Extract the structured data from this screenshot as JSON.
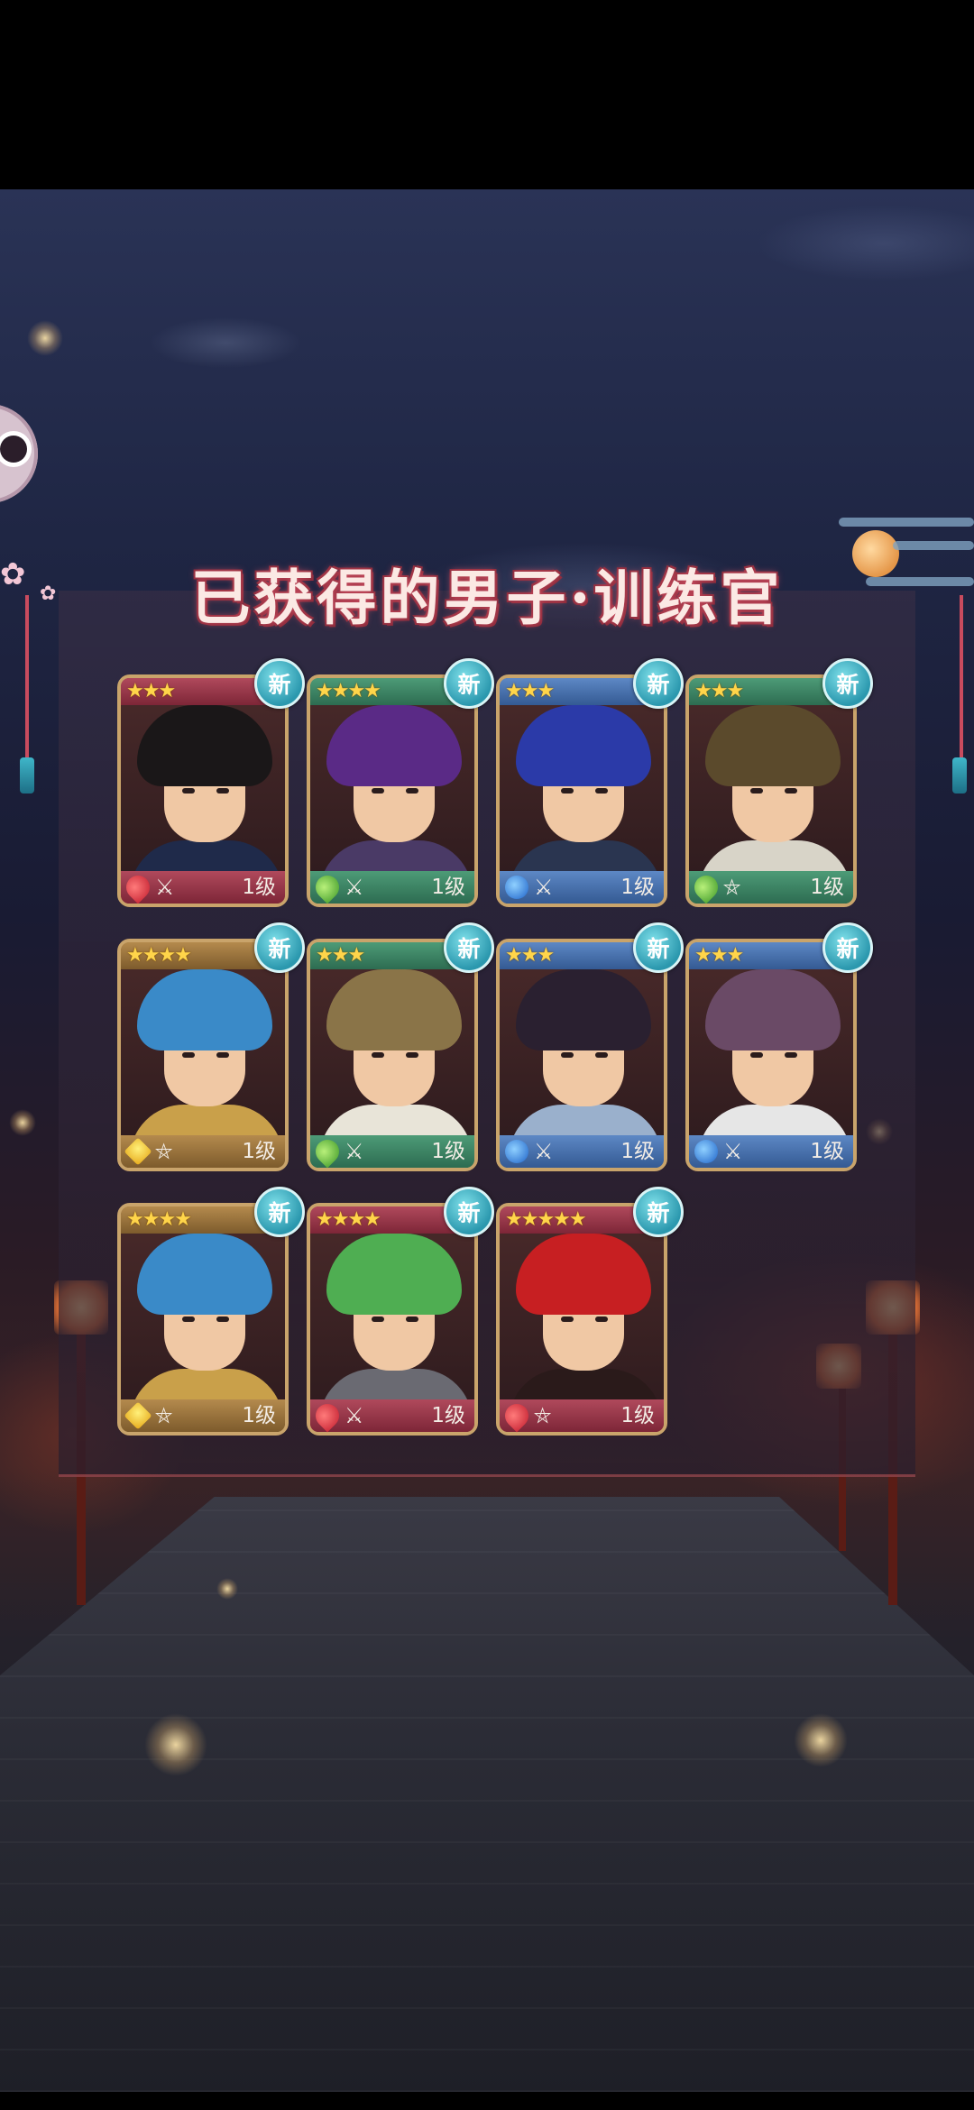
{
  "title": "已获得的男子·训练官",
  "cards": [
    {
      "stars": "★★★",
      "badge": "新",
      "element": "fire",
      "weapon": "⚔",
      "level": "1级",
      "theme": "red",
      "hair": "#1a1718",
      "outfit": "#1f2a4a"
    },
    {
      "stars": "★★★★",
      "badge": "新",
      "element": "leaf",
      "weapon": "⚔",
      "level": "1级",
      "theme": "green",
      "hair": "#5a2a86",
      "outfit": "#4a3a66"
    },
    {
      "stars": "★★★",
      "badge": "新",
      "element": "water",
      "weapon": "⚔",
      "level": "1级",
      "theme": "blue",
      "hair": "#2b3aa8",
      "outfit": "#2a3550"
    },
    {
      "stars": "★★★",
      "badge": "新",
      "element": "leaf",
      "weapon": "⛤",
      "level": "1级",
      "theme": "green",
      "hair": "#5b4a2c",
      "outfit": "#d8d4c8"
    },
    {
      "stars": "★★★★",
      "badge": "新",
      "element": "thunder",
      "weapon": "⛤",
      "level": "1级",
      "theme": "gold",
      "hair": "#3a8ac8",
      "outfit": "#c9a04a"
    },
    {
      "stars": "★★★",
      "badge": "新",
      "element": "leaf",
      "weapon": "⚔",
      "level": "1级",
      "theme": "green",
      "hair": "#8a7448",
      "outfit": "#e8e4d8"
    },
    {
      "stars": "★★★",
      "badge": "新",
      "element": "water",
      "weapon": "⚔",
      "level": "1级",
      "theme": "blue",
      "hair": "#2a2030",
      "outfit": "#9ab0cc"
    },
    {
      "stars": "★★★",
      "badge": "新",
      "element": "water",
      "weapon": "⚔",
      "level": "1级",
      "theme": "blue",
      "hair": "#6a4a66",
      "outfit": "#e6e6e6"
    },
    {
      "stars": "★★★★",
      "badge": "新",
      "element": "thunder",
      "weapon": "⛤",
      "level": "1级",
      "theme": "gold",
      "hair": "#3a8ac8",
      "outfit": "#c9a04a"
    },
    {
      "stars": "★★★★",
      "badge": "新",
      "element": "fire",
      "weapon": "⚔",
      "level": "1级",
      "theme": "red",
      "hair": "#4fae52",
      "outfit": "#6a6a72"
    },
    {
      "stars": "★★★★★",
      "badge": "新",
      "element": "fire",
      "weapon": "⛤",
      "level": "1级",
      "theme": "red",
      "hair": "#c71f22",
      "outfit": "#2a1a1a"
    }
  ]
}
